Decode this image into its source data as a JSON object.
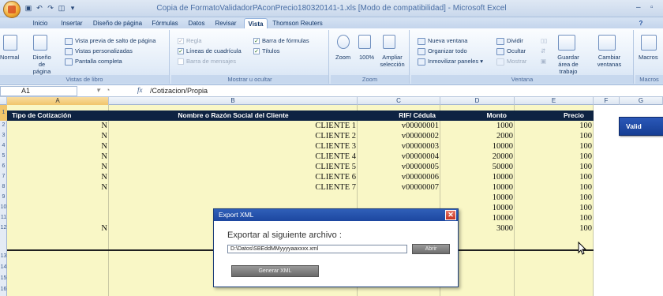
{
  "window": {
    "title": "Copia de FormatoValidadorPAconPrecio180320141-1.xls  [Modo de compatibilidad] - Microsoft Excel",
    "minimize": "–",
    "maximize": "▫"
  },
  "ribbon_tabs": [
    "Inicio",
    "Insertar",
    "Diseño de página",
    "Fórmulas",
    "Datos",
    "Revisar",
    "Vista",
    "Thomson Reuters"
  ],
  "ribbon": {
    "vistas_libro": {
      "normal": "Normal",
      "diseno_pagina": "Diseño de página",
      "vista_previa": "Vista previa de salto de página",
      "vistas_personalizadas": "Vistas personalizadas",
      "pantalla_completa": "Pantalla completa",
      "label": "Vistas de libro"
    },
    "mostrar": {
      "regla": "Regla",
      "lineas": "Líneas de cuadrícula",
      "barra_mensajes": "Barra de mensajes",
      "barra_formulas": "Barra de fórmulas",
      "titulos": "Títulos",
      "label": "Mostrar u ocultar"
    },
    "zoom": {
      "zoom": "Zoom",
      "pct": "100%",
      "ampliar": "Ampliar selección",
      "label": "Zoom"
    },
    "ventana": {
      "nueva": "Nueva ventana",
      "organizar": "Organizar todo",
      "inmovilizar": "Inmovilizar paneles",
      "dividir": "Dividir",
      "ocultar": "Ocultar",
      "mostrar": "Mostrar",
      "guardar_area": "Guardar área de trabajo",
      "cambiar": "Cambiar ventanas",
      "label": "Ventana"
    },
    "macros": {
      "macros": "Macros",
      "label": "Macros"
    }
  },
  "formula_bar": {
    "cell_ref": "A1",
    "fx": "fx",
    "formula": "/Cotizacion/Propia"
  },
  "columns": [
    "A",
    "B",
    "C",
    "D",
    "E",
    "F",
    "G"
  ],
  "rows": [
    "1",
    "2",
    "3",
    "4",
    "5",
    "6",
    "7",
    "8",
    "9",
    "10",
    "11",
    "12",
    "13",
    "14",
    "15",
    "16"
  ],
  "table": {
    "headers": [
      "Tipo de Cotización",
      "Nombre o Razón Social del Cliente",
      "RIF/ Cédula",
      "Monto",
      "Precio"
    ],
    "rows": [
      [
        "N",
        "CLIENTE 1",
        "v00000001",
        "1000",
        "100"
      ],
      [
        "N",
        "CLIENTE 2",
        "v00000002",
        "2000",
        "100"
      ],
      [
        "N",
        "CLIENTE 3",
        "v00000003",
        "10000",
        "100"
      ],
      [
        "N",
        "CLIENTE 4",
        "v00000004",
        "20000",
        "100"
      ],
      [
        "N",
        "CLIENTE 5",
        "v00000005",
        "50000",
        "100"
      ],
      [
        "N",
        "CLIENTE 6",
        "v00000006",
        "10000",
        "100"
      ],
      [
        "N",
        "CLIENTE 7",
        "v00000007",
        "10000",
        "100"
      ],
      [
        "",
        "",
        "",
        "10000",
        "100"
      ],
      [
        "",
        "",
        "",
        "10000",
        "100"
      ],
      [
        "",
        "",
        "",
        "10000",
        "100"
      ],
      [
        "N",
        "",
        "",
        "3000",
        "100"
      ]
    ]
  },
  "validate_button": "Valid",
  "dialog": {
    "title": "Export XML",
    "close": "✕",
    "label": "Exportar al siguiente archivo :",
    "path_value": "D:\\Datos\\SBEddMMyyyyaaxxxx.xml",
    "browse": "Abrir",
    "generate": "Generar XML"
  }
}
